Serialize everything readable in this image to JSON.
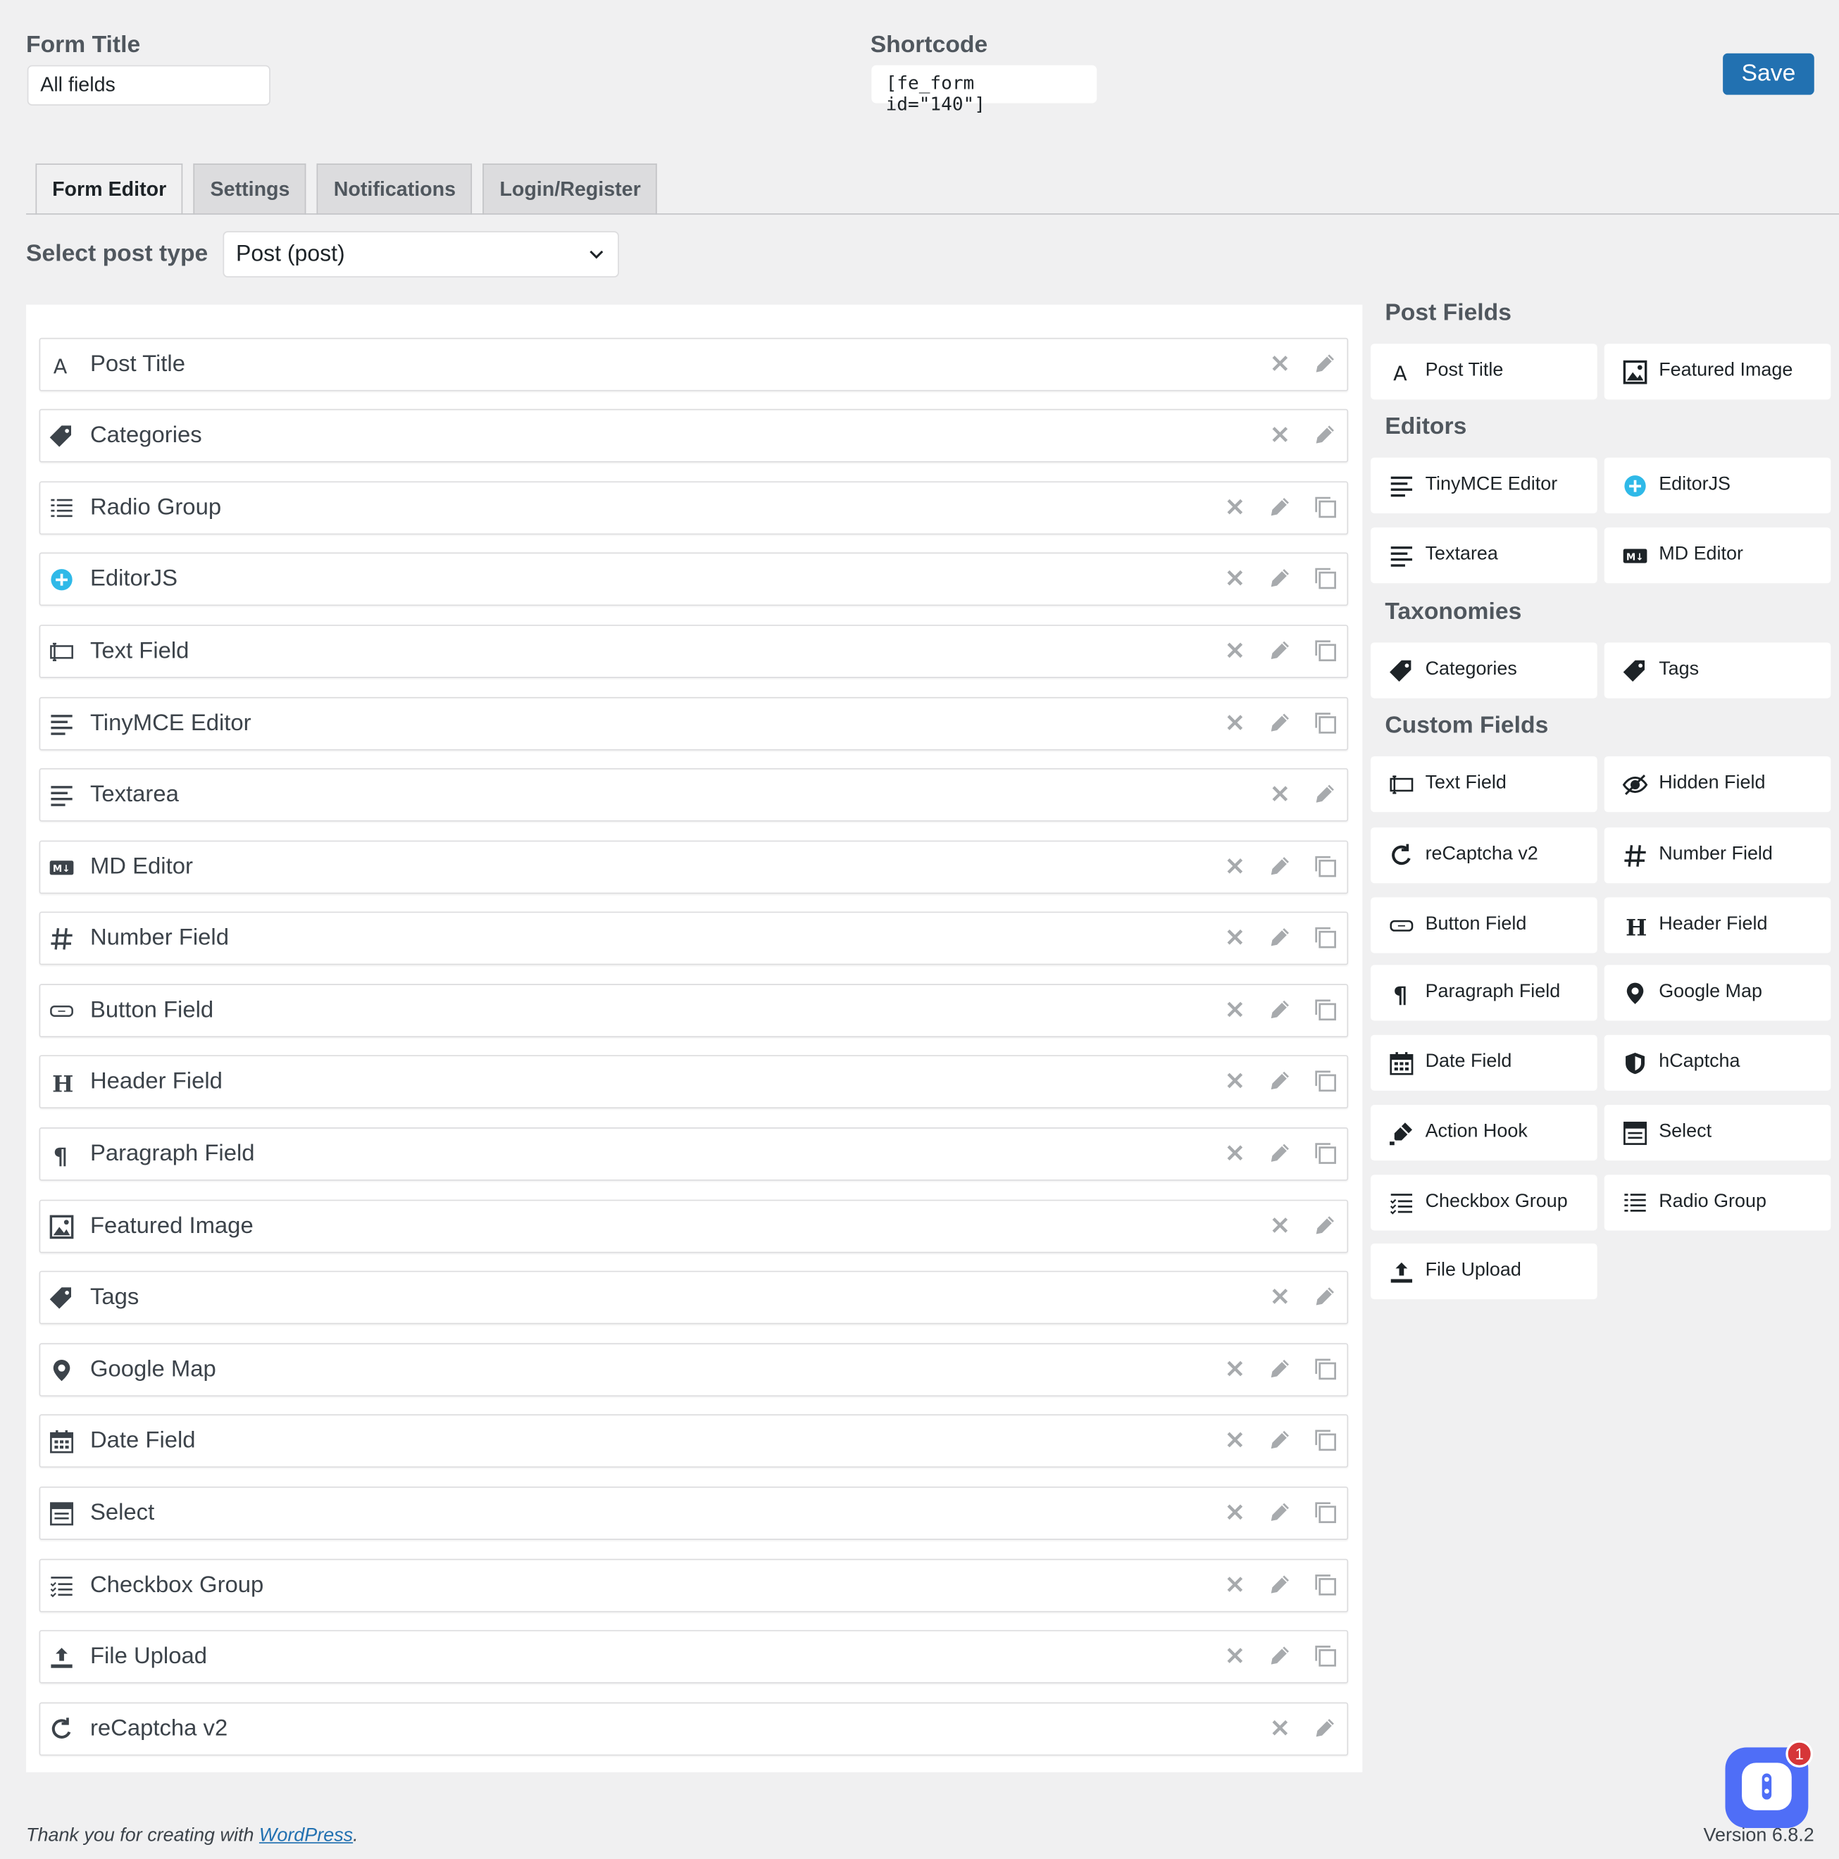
{
  "header": {
    "form_title_label": "Form Title",
    "form_title_value": "All fields",
    "shortcode_label": "Shortcode",
    "shortcode_value": "[fe_form id=\"140\"]",
    "save_label": "Save"
  },
  "tabs": [
    {
      "label": "Form Editor",
      "active": true
    },
    {
      "label": "Settings",
      "active": false
    },
    {
      "label": "Notifications",
      "active": false
    },
    {
      "label": "Login/Register",
      "active": false
    }
  ],
  "post_type": {
    "label": "Select post type",
    "selected": "Post (post)"
  },
  "form_fields": [
    {
      "label": "Post Title",
      "icon": "text-a-icon",
      "duplicable": false
    },
    {
      "label": "Categories",
      "icon": "tag-icon",
      "duplicable": false
    },
    {
      "label": "Radio Group",
      "icon": "list-icon",
      "duplicable": true
    },
    {
      "label": "EditorJS",
      "icon": "editorjs-plus-icon",
      "duplicable": true
    },
    {
      "label": "Text Field",
      "icon": "text-field-icon",
      "duplicable": true
    },
    {
      "label": "TinyMCE Editor",
      "icon": "editor-lines-icon",
      "duplicable": true
    },
    {
      "label": "Textarea",
      "icon": "editor-lines-icon",
      "duplicable": false
    },
    {
      "label": "MD Editor",
      "icon": "markdown-icon",
      "duplicable": true
    },
    {
      "label": "Number Field",
      "icon": "hash-icon",
      "duplicable": true
    },
    {
      "label": "Button Field",
      "icon": "button-icon",
      "duplicable": true
    },
    {
      "label": "Header Field",
      "icon": "heading-icon",
      "duplicable": true
    },
    {
      "label": "Paragraph Field",
      "icon": "paragraph-icon",
      "duplicable": true
    },
    {
      "label": "Featured Image",
      "icon": "image-icon",
      "duplicable": false
    },
    {
      "label": "Tags",
      "icon": "tag-icon",
      "duplicable": false
    },
    {
      "label": "Google Map",
      "icon": "map-pin-icon",
      "duplicable": true
    },
    {
      "label": "Date Field",
      "icon": "calendar-icon",
      "duplicable": true
    },
    {
      "label": "Select",
      "icon": "select-icon",
      "duplicable": true
    },
    {
      "label": "Checkbox Group",
      "icon": "checklist-icon",
      "duplicable": true
    },
    {
      "label": "File Upload",
      "icon": "upload-icon",
      "duplicable": true
    },
    {
      "label": "reCaptcha v2",
      "icon": "recaptcha-icon",
      "duplicable": false
    }
  ],
  "sidebar": {
    "sections": [
      {
        "title": "Post Fields",
        "items": [
          {
            "label": "Post Title",
            "icon": "text-a-icon"
          },
          {
            "label": "Featured Image",
            "icon": "image-icon"
          }
        ]
      },
      {
        "title": "Editors",
        "items": [
          {
            "label": "TinyMCE Editor",
            "icon": "editor-lines-icon"
          },
          {
            "label": "EditorJS",
            "icon": "editorjs-plus-icon"
          },
          {
            "label": "Textarea",
            "icon": "editor-lines-icon"
          },
          {
            "label": "MD Editor",
            "icon": "markdown-icon"
          }
        ]
      },
      {
        "title": "Taxonomies",
        "items": [
          {
            "label": "Categories",
            "icon": "tag-icon"
          },
          {
            "label": "Tags",
            "icon": "tag-icon"
          }
        ]
      },
      {
        "title": "Custom Fields",
        "items": [
          {
            "label": "Text Field",
            "icon": "text-field-icon"
          },
          {
            "label": "Hidden Field",
            "icon": "eye-slash-icon"
          },
          {
            "label": "reCaptcha v2",
            "icon": "recaptcha-icon"
          },
          {
            "label": "Number Field",
            "icon": "hash-icon"
          },
          {
            "label": "Button Field",
            "icon": "button-icon"
          },
          {
            "label": "Header Field",
            "icon": "heading-icon"
          },
          {
            "label": "Paragraph Field",
            "icon": "paragraph-icon"
          },
          {
            "label": "Google Map",
            "icon": "map-pin-icon"
          },
          {
            "label": "Date Field",
            "icon": "calendar-icon"
          },
          {
            "label": "hCaptcha",
            "icon": "shield-icon"
          },
          {
            "label": "Action Hook",
            "icon": "hook-icon"
          },
          {
            "label": "Select",
            "icon": "select-icon"
          },
          {
            "label": "Checkbox Group",
            "icon": "checklist-icon"
          },
          {
            "label": "Radio Group",
            "icon": "list-icon"
          },
          {
            "label": "File Upload",
            "icon": "upload-icon"
          }
        ]
      }
    ]
  },
  "footer": {
    "thanks_prefix": "Thank you for creating with ",
    "wordpress_link": "WordPress",
    "thanks_suffix": ".",
    "version": "Version 6.8.2"
  },
  "chat_widget": {
    "badge_count": "1"
  },
  "colors": {
    "accent": "#2271b1",
    "background": "#f0f0f1",
    "chat": "#4f6ef7",
    "badge": "#d63638"
  }
}
